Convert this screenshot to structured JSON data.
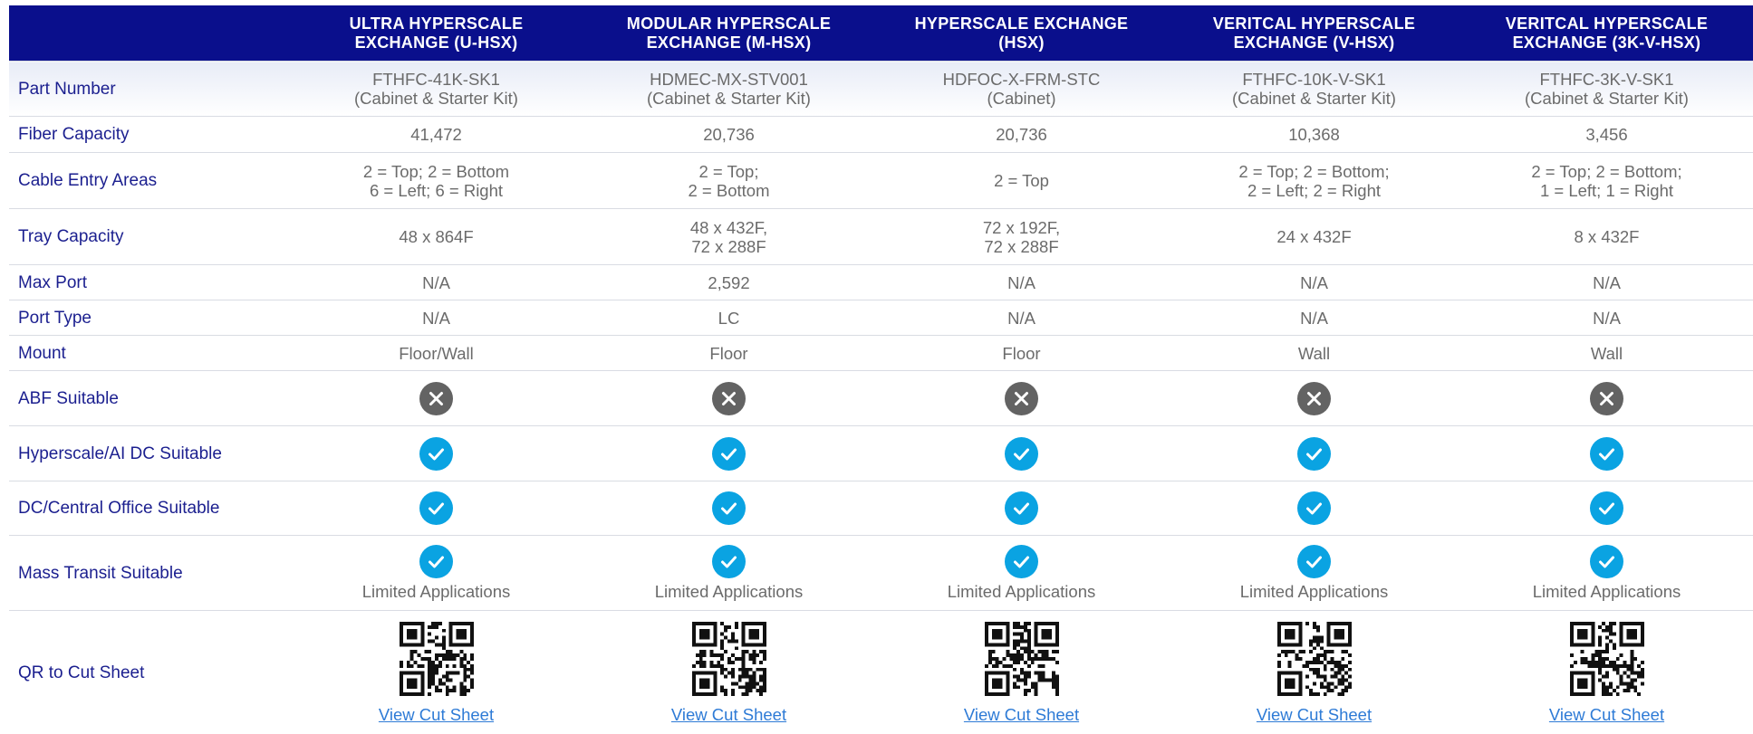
{
  "header": {
    "columns": [
      "ULTRA HYPERSCALE EXCHANGE (U-HSX)",
      "MODULAR HYPERSCALE EXCHANGE (M-HSX)",
      "HYPERSCALE EXCHANGE (HSX)",
      "VERITCAL HYPERSCALE EXCHANGE (V-HSX)",
      "VERITCAL HYPERSCALE EXCHANGE (3K-V-HSX)"
    ],
    "columns_lines": [
      [
        "ULTRA HYPERSCALE",
        "EXCHANGE (U-HSX)"
      ],
      [
        "MODULAR HYPERSCALE",
        "EXCHANGE (M-HSX)"
      ],
      [
        "HYPERSCALE EXCHANGE",
        "(HSX)"
      ],
      [
        "VERITCAL HYPERSCALE",
        "EXCHANGE (V-HSX)"
      ],
      [
        "VERITCAL HYPERSCALE",
        "EXCHANGE (3K-V-HSX)"
      ]
    ]
  },
  "rows": {
    "part_number": {
      "label": "Part Number",
      "values": [
        [
          "FTHFC-41K-SK1",
          "(Cabinet & Starter Kit)"
        ],
        [
          "HDMEC-MX-STV001",
          "(Cabinet & Starter Kit)"
        ],
        [
          "HDFOC-X-FRM-STC",
          "(Cabinet)"
        ],
        [
          "FTHFC-10K-V-SK1",
          "(Cabinet & Starter Kit)"
        ],
        [
          "FTHFC-3K-V-SK1",
          "(Cabinet & Starter Kit)"
        ]
      ]
    },
    "fiber_capacity": {
      "label": "Fiber Capacity",
      "values": [
        "41,472",
        "20,736",
        "20,736",
        "10,368",
        "3,456"
      ]
    },
    "cable_entry": {
      "label": "Cable Entry Areas",
      "values": [
        [
          "2 = Top; 2 = Bottom",
          "6 = Left; 6 = Right"
        ],
        [
          "2 = Top;",
          "2 = Bottom"
        ],
        [
          "2 = Top"
        ],
        [
          "2 = Top; 2 = Bottom;",
          "2 = Left; 2 = Right"
        ],
        [
          "2 = Top; 2 = Bottom;",
          "1 = Left; 1 = Right"
        ]
      ]
    },
    "tray_capacity": {
      "label": "Tray Capacity",
      "values": [
        [
          "48 x 864F"
        ],
        [
          "48 x 432F,",
          "72 x 288F"
        ],
        [
          "72 x 192F,",
          "72 x 288F"
        ],
        [
          "24 x 432F"
        ],
        [
          "8 x 432F"
        ]
      ]
    },
    "max_port": {
      "label": "Max Port",
      "values": [
        "N/A",
        "2,592",
        "N/A",
        "N/A",
        "N/A"
      ]
    },
    "port_type": {
      "label": "Port Type",
      "values": [
        "N/A",
        "LC",
        "N/A",
        "N/A",
        "N/A"
      ]
    },
    "mount": {
      "label": "Mount",
      "values": [
        "Floor/Wall",
        "Floor",
        "Floor",
        "Wall",
        "Wall"
      ]
    },
    "abf": {
      "label": "ABF Suitable",
      "icons": [
        "x-circle-icon",
        "x-circle-icon",
        "x-circle-icon",
        "x-circle-icon",
        "x-circle-icon"
      ]
    },
    "hyperscale": {
      "label": "Hyperscale/AI DC Suitable",
      "icons": [
        "check-circle-icon",
        "check-circle-icon",
        "check-circle-icon",
        "check-circle-icon",
        "check-circle-icon"
      ]
    },
    "dc_central": {
      "label": "DC/Central Office Suitable",
      "icons": [
        "check-circle-icon",
        "check-circle-icon",
        "check-circle-icon",
        "check-circle-icon",
        "check-circle-icon"
      ]
    },
    "mass_transit": {
      "label": "Mass Transit Suitable",
      "icons": [
        "check-circle-icon",
        "check-circle-icon",
        "check-circle-icon",
        "check-circle-icon",
        "check-circle-icon"
      ],
      "notes": [
        "Limited Applications",
        "Limited Applications",
        "Limited Applications",
        "Limited Applications",
        "Limited Applications"
      ]
    },
    "qr": {
      "label": "QR to Cut Sheet",
      "icons": [
        "qr-code-icon",
        "qr-code-icon",
        "qr-code-icon",
        "qr-code-icon",
        "qr-code-icon"
      ],
      "links": [
        "View Cut Sheet",
        "View Cut Sheet",
        "View Cut Sheet",
        "View Cut Sheet",
        "View Cut Sheet"
      ]
    }
  },
  "colors": {
    "header_bg": "#0a0f8c",
    "label_text": "#1b1f8f",
    "value_text": "#6b6b6b",
    "check": "#0aa3e2",
    "x": "#636363",
    "link": "#2e7bd6"
  }
}
